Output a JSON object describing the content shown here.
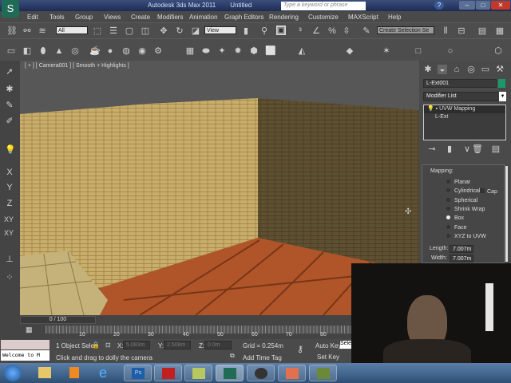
{
  "titlebar": {
    "app": "Autodesk 3ds Max 2011",
    "doc": "Untitled",
    "search_placeholder": "Type a keyword or phrase"
  },
  "menu": [
    "Edit",
    "Tools",
    "Group",
    "Views",
    "Create",
    "Modifiers",
    "Animation",
    "Graph Editors",
    "Rendering",
    "Customize",
    "MAXScript",
    "Help"
  ],
  "toolbar": {
    "filter": "All",
    "refcoord": "View",
    "selection_set": "Create Selection Se"
  },
  "viewport": {
    "label": "[ + ] [ Camera001 ] [ Smooth + Highlights ]"
  },
  "panel": {
    "object_name": "L-Ext001",
    "object_color": "#1a9a6a",
    "modifier_list": "Modifier List",
    "stack": [
      "UVW Mapping",
      "L-Ext"
    ],
    "mapping_title": "Mapping:",
    "mapping_options": [
      "Planar",
      "Cylindrical",
      "Spherical",
      "Shrink Wrap",
      "Box",
      "Face",
      "XYZ to UVW"
    ],
    "selected": "Box",
    "cap_label": "Cap",
    "length_label": "Length:",
    "length": "7.007m",
    "width_label": "Width:",
    "width": "7.007m"
  },
  "timeline": {
    "frame": "0 / 100",
    "ticks": [
      "10",
      "20",
      "30",
      "40",
      "50",
      "60",
      "70",
      "80"
    ]
  },
  "status": {
    "selection": "1 Object Sele",
    "x_label": "X:",
    "x": "5.083m",
    "y_label": "Y:",
    "y": "2.508m",
    "z_label": "Z:",
    "z": "0.0m",
    "grid": "Grid = 0.254m",
    "prompt": "Click and drag to dolly the camera",
    "add_time_tag": "Add Time Tag",
    "auto_key": "Auto Key",
    "set_key": "Set Key",
    "selected_dd": "Sele",
    "listener": "Welcome to M"
  }
}
